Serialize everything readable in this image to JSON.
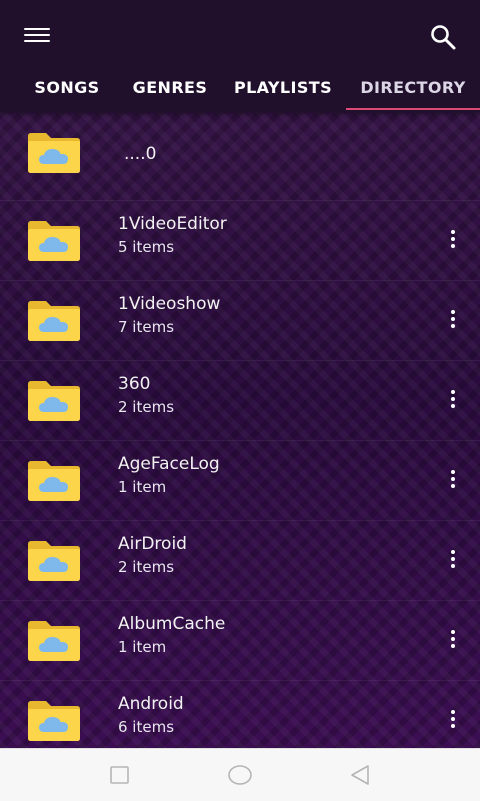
{
  "header": {
    "menu_icon": "hamburger-menu-icon",
    "search_icon": "search-icon",
    "tabs": [
      {
        "label": "SONGS"
      },
      {
        "label": "GENRES"
      },
      {
        "label": "PLAYLISTS"
      },
      {
        "label": "DIRECTORY",
        "active": true
      }
    ]
  },
  "directory": {
    "parent": {
      "name": "....0"
    },
    "folders": [
      {
        "name": "1VideoEditor",
        "count": "5 items"
      },
      {
        "name": "1Videoshow",
        "count": "7 items"
      },
      {
        "name": "360",
        "count": "2 items"
      },
      {
        "name": "AgeFaceLog",
        "count": "1 item"
      },
      {
        "name": "AirDroid",
        "count": "2 items"
      },
      {
        "name": "AlbumCache",
        "count": "1 item"
      },
      {
        "name": "Android",
        "count": "6 items"
      }
    ]
  },
  "navbar": {
    "buttons": [
      "recents-square-icon",
      "home-circle-icon",
      "back-triangle-icon"
    ]
  },
  "colors": {
    "background": "#2c0f3d",
    "topbar": "#20102c",
    "accent": "#d94a76",
    "folder": "#fcd54a",
    "cloud": "#7fb8ea"
  }
}
